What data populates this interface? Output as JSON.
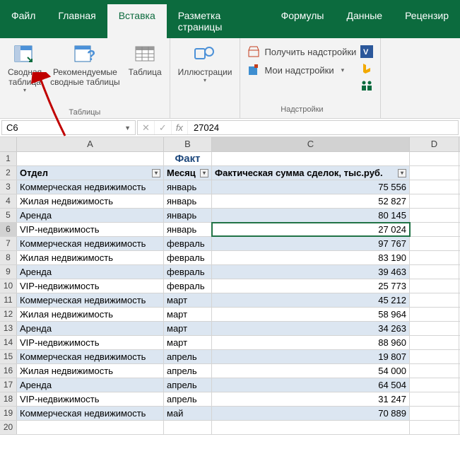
{
  "ribbon": {
    "tabs": [
      "Файл",
      "Главная",
      "Вставка",
      "Разметка страницы",
      "Формулы",
      "Данные",
      "Рецензир"
    ],
    "active_tab": "Вставка",
    "groups": {
      "tables_label": "Таблицы",
      "addins_label": "Надстройки"
    },
    "buttons": {
      "pivot": "Сводная\nтаблица",
      "recommended_pivot": "Рекомендуемые\nсводные таблицы",
      "table": "Таблица",
      "illustrations": "Иллюстрации",
      "get_addins": "Получить надстройки",
      "my_addins": "Мои надстройки"
    }
  },
  "formula_bar": {
    "name_box": "C6",
    "formula_value": "27024"
  },
  "columns": [
    "A",
    "B",
    "C",
    "D"
  ],
  "title_cell": "Факт",
  "headers": {
    "A": "Отдел",
    "B": "Месяц",
    "C": "Фактическая сумма сделок, тыс.руб."
  },
  "selected_cell": {
    "row": 6,
    "col": "C"
  },
  "rows": [
    {
      "n": 3,
      "band": true,
      "A": "Коммерческая недвижимость",
      "B": "январь",
      "C": "75 556"
    },
    {
      "n": 4,
      "band": false,
      "A": "Жилая недвижимость",
      "B": "январь",
      "C": "52 827"
    },
    {
      "n": 5,
      "band": true,
      "A": "Аренда",
      "B": "январь",
      "C": "80 145"
    },
    {
      "n": 6,
      "band": false,
      "A": "VIP-недвижимость",
      "B": "январь",
      "C": "27 024"
    },
    {
      "n": 7,
      "band": true,
      "A": "Коммерческая недвижимость",
      "B": "февраль",
      "C": "97 767"
    },
    {
      "n": 8,
      "band": false,
      "A": "Жилая недвижимость",
      "B": "февраль",
      "C": "83 190"
    },
    {
      "n": 9,
      "band": true,
      "A": "Аренда",
      "B": "февраль",
      "C": "39 463"
    },
    {
      "n": 10,
      "band": false,
      "A": "VIP-недвижимость",
      "B": "февраль",
      "C": "25 773"
    },
    {
      "n": 11,
      "band": true,
      "A": "Коммерческая недвижимость",
      "B": "март",
      "C": "45 212"
    },
    {
      "n": 12,
      "band": false,
      "A": "Жилая недвижимость",
      "B": "март",
      "C": "58 964"
    },
    {
      "n": 13,
      "band": true,
      "A": "Аренда",
      "B": "март",
      "C": "34 263"
    },
    {
      "n": 14,
      "band": false,
      "A": "VIP-недвижимость",
      "B": "март",
      "C": "88 960"
    },
    {
      "n": 15,
      "band": true,
      "A": "Коммерческая недвижимость",
      "B": "апрель",
      "C": "19 807"
    },
    {
      "n": 16,
      "band": false,
      "A": "Жилая недвижимость",
      "B": "апрель",
      "C": "54 000"
    },
    {
      "n": 17,
      "band": true,
      "A": "Аренда",
      "B": "апрель",
      "C": "64 504"
    },
    {
      "n": 18,
      "band": false,
      "A": "VIP-недвижимость",
      "B": "апрель",
      "C": "31 247"
    },
    {
      "n": 19,
      "band": true,
      "A": "Коммерческая недвижимость",
      "B": "май",
      "C": "70 889"
    }
  ]
}
